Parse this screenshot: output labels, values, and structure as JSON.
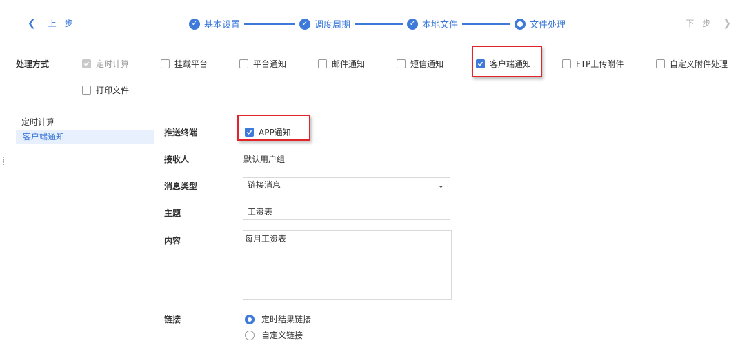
{
  "nav": {
    "prev_label": "上一步",
    "next_label": "下一步",
    "steps": [
      {
        "label": "基本设置",
        "state": "done"
      },
      {
        "label": "调度周期",
        "state": "done"
      },
      {
        "label": "本地文件",
        "state": "done"
      },
      {
        "label": "文件处理",
        "state": "current"
      }
    ]
  },
  "methods": {
    "label": "处理方式",
    "options": [
      {
        "label": "定时计算",
        "checked": true,
        "disabled": true
      },
      {
        "label": "挂载平台",
        "checked": false
      },
      {
        "label": "平台通知",
        "checked": false
      },
      {
        "label": "邮件通知",
        "checked": false
      },
      {
        "label": "短信通知",
        "checked": false
      },
      {
        "label": "客户端通知",
        "checked": true
      },
      {
        "label": "FTP上传附件",
        "checked": false
      },
      {
        "label": "自定义附件处理",
        "checked": false
      },
      {
        "label": "打印文件",
        "checked": false
      }
    ]
  },
  "sidebar": {
    "items": [
      {
        "label": "定时计算",
        "active": false
      },
      {
        "label": "客户端通知",
        "active": true
      }
    ]
  },
  "form": {
    "push_terminal_label": "推送终端",
    "push_terminal_option": "APP通知",
    "recipient_label": "接收人",
    "recipient_value": "默认用户组",
    "message_type_label": "消息类型",
    "message_type_value": "链接消息",
    "subject_label": "主题",
    "subject_value": "工资表",
    "content_label": "内容",
    "content_value": "每月工资表",
    "link_label": "链接",
    "link_options": [
      {
        "label": "定时结果链接",
        "selected": true
      },
      {
        "label": "自定义链接",
        "selected": false
      }
    ]
  },
  "colors": {
    "accent": "#3d7ad9",
    "highlight_box": "#e2252b"
  }
}
